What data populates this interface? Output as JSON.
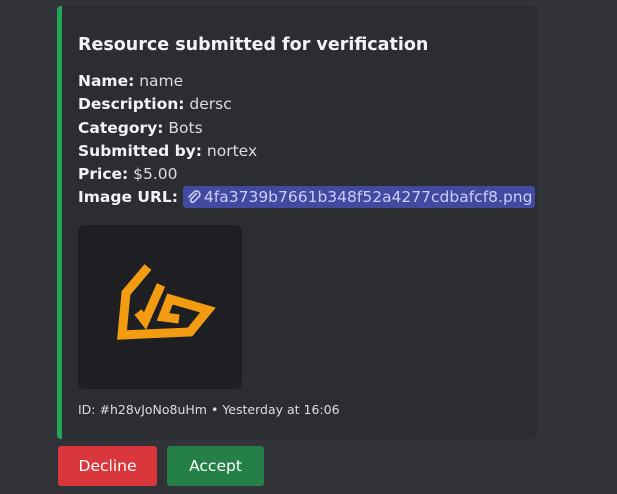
{
  "embed": {
    "accent_color": "#23a559",
    "title": "Resource submitted for verification",
    "fields": [
      {
        "label": "Name:",
        "value": "name"
      },
      {
        "label": "Description:",
        "value": "dersc"
      },
      {
        "label": "Category:",
        "value": "Bots"
      },
      {
        "label": "Submitted by:",
        "value": "nortex"
      },
      {
        "label": "Price:",
        "value": "$5.00"
      }
    ],
    "image_url": {
      "label": "Image URL:",
      "link": "4fa3739b7661b348f52a4277cdbafcf8.png",
      "icon": "paperclip-icon"
    },
    "thumbnail": {
      "logo_color": "#f39c12"
    },
    "footer": {
      "id": "ID: #h28vJoNo8uHm",
      "separator": "•",
      "timestamp": "Yesterday at 16:06"
    }
  },
  "buttons": {
    "decline": "Decline",
    "accept": "Accept"
  }
}
